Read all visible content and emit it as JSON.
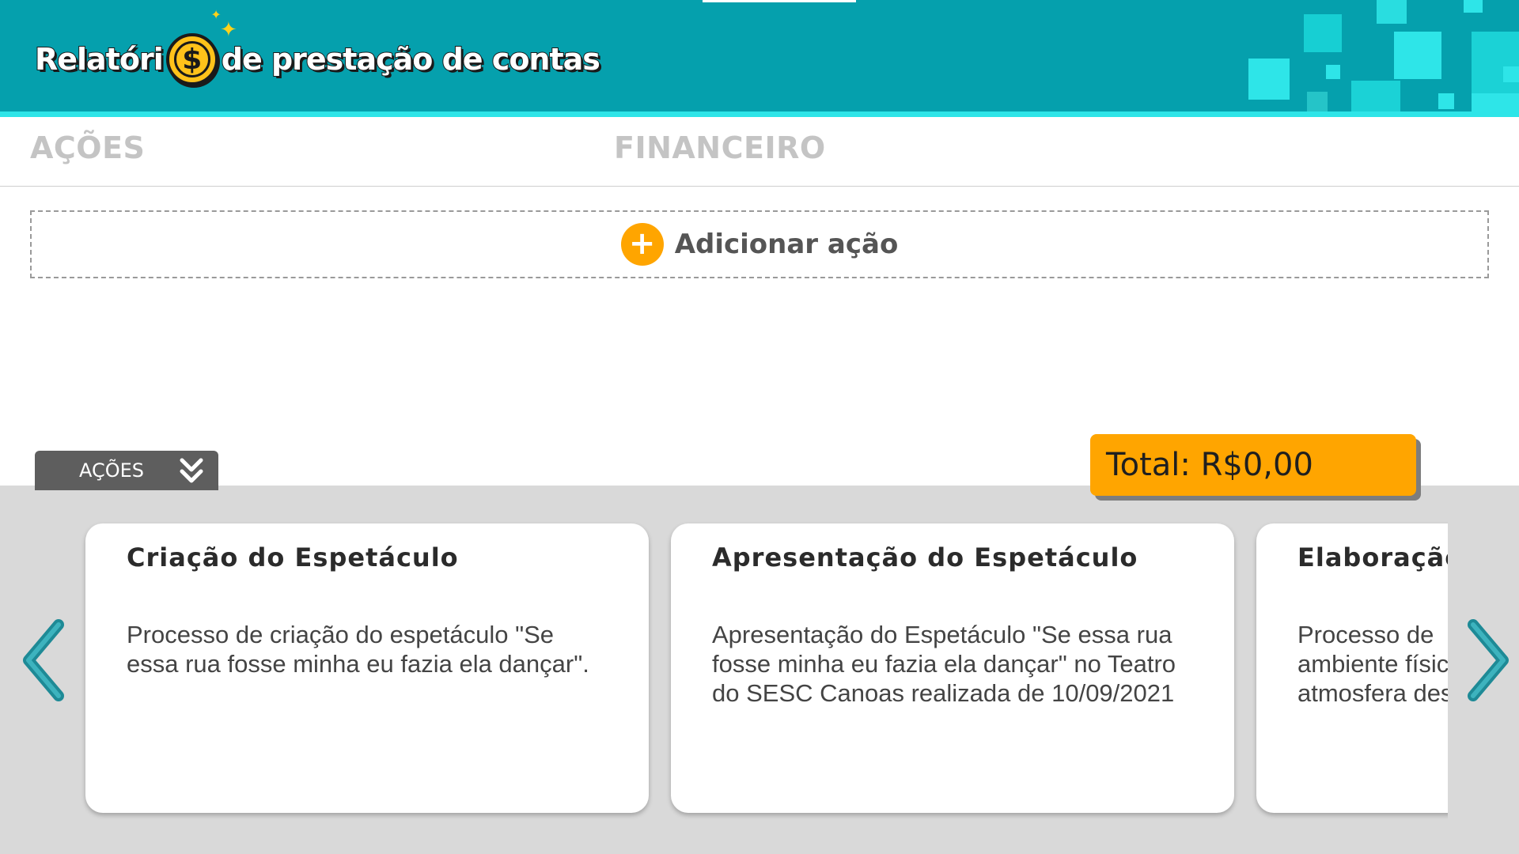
{
  "header": {
    "logo_part1": "Relatóri",
    "logo_coin_symbol": "$",
    "logo_part2": "de prestação de contas",
    "colors": {
      "background": "#05a0ad",
      "accent": "#2ee5e8",
      "coin": "#ffc21a"
    }
  },
  "tabs": [
    {
      "label": "AÇÕES"
    },
    {
      "label": "FINANCEIRO"
    }
  ],
  "add_action": {
    "icon": "plus-circle-icon",
    "label": "Adicionar ação"
  },
  "actions_toggle": {
    "label": "AÇÕES",
    "icon": "double-chevron-down-icon"
  },
  "total": {
    "text": "Total: R$0,00"
  },
  "cards": [
    {
      "title": "Criação do Espetáculo",
      "description": "Processo de criação do espetáculo \"Se essa rua fosse minha eu fazia ela dançar\"."
    },
    {
      "title": "Apresentação do Espetáculo",
      "description": "Apresentação do Espetáculo \"Se essa rua fosse minha eu fazia ela dançar\" no Teatro do SESC Canoas realizada de 10/09/2021"
    },
    {
      "title": "Elaboração",
      "description": "Processo de \nambiente físic\natmosfera des"
    }
  ],
  "carousel": {
    "prev_icon": "chevron-left-icon",
    "next_icon": "chevron-right-icon",
    "arrow_color": "#1e8a96"
  },
  "colors": {
    "orange": "#ffa500",
    "panel": "#d9d9d9",
    "toggle": "#5e5e5e"
  }
}
